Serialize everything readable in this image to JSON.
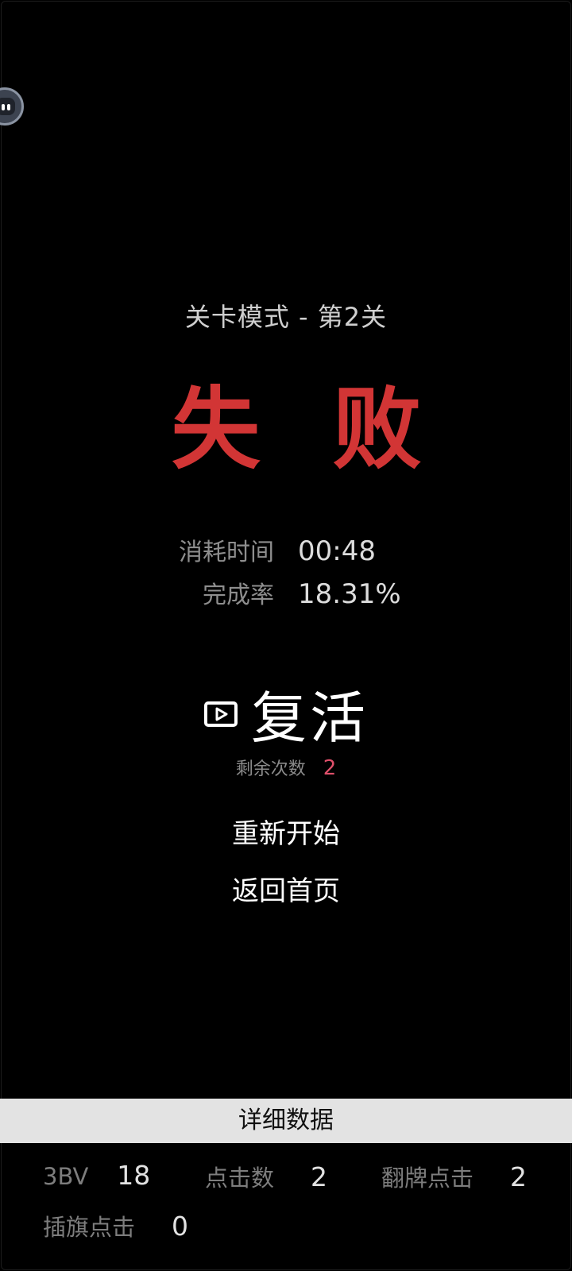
{
  "header": {
    "mode_title": "关卡模式 - 第2关"
  },
  "result": {
    "title": "失 败",
    "color": "#d23535"
  },
  "stats": [
    {
      "label": "消耗时间",
      "value": "00:48"
    },
    {
      "label": "完成率",
      "value": "18.31%"
    }
  ],
  "revive": {
    "icon": "video-ad-icon",
    "label": "复活",
    "remaining_label": "剩余次数",
    "remaining_count": "2",
    "count_color": "#e0506b"
  },
  "menu": {
    "restart_label": "重新开始",
    "home_label": "返回首页"
  },
  "details": {
    "header": "详细数据",
    "items": [
      {
        "label": "3BV",
        "value": "18"
      },
      {
        "label": "点击数",
        "value": "2"
      },
      {
        "label": "翻牌点击",
        "value": "2"
      },
      {
        "label": "插旗点击",
        "value": "0"
      }
    ]
  },
  "floating_button": {
    "icon": "assistant-bubble-icon"
  }
}
